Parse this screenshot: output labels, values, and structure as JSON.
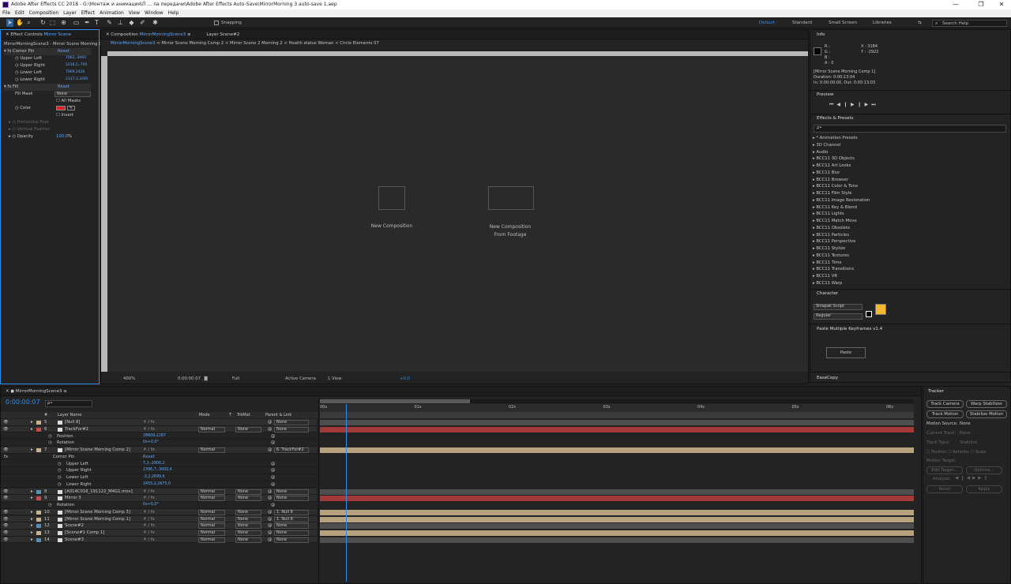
{
  "window": {
    "title": "Adobe After Effects CC 2018 - G:\\Монтаж и анимация\\П ... ла передачи\\Adobe After Effects Auto-Save\\MirrorMorning 3 auto-save 1.aep",
    "minimize": "—",
    "maximize": "❐",
    "close": "✕"
  },
  "menu": [
    "File",
    "Edit",
    "Composition",
    "Layer",
    "Effect",
    "Animation",
    "View",
    "Window",
    "Help"
  ],
  "toolbar": {
    "snapping": "Snapping",
    "workspaces": [
      "Default",
      "Standard",
      "Small Screen",
      "Libraries"
    ],
    "search_placeholder": "Search Help"
  },
  "effect_controls": {
    "tab": "Effect Controls",
    "layer": "Mirror Scene",
    "header": "MirrorMorningScene3 - Mirror Scene Morning Co",
    "corner_pin": "Corner Pin",
    "reset": "Reset",
    "ul": "Upper Left",
    "ul_v": "7062,-3093",
    "ur": "Upper Right",
    "ur_v": "2236,5,-700",
    "ll": "Lower Left",
    "ll_v": "7069,2426",
    "lr": "Lower Right",
    "lr_v": "2137,3,3295",
    "fill": "Fill",
    "fill_reset": "Reset",
    "fill_mask": "Fill Mask",
    "none": "None",
    "all_masks": "All Masks",
    "color": "Color",
    "invert": "Invert",
    "hfeather": "Horizontal Feat",
    "vfeather": "Vertical Feather",
    "opacity": "Opacity",
    "opacity_v": "100,0",
    "pct": "%"
  },
  "composition": {
    "tab": "Composition",
    "comp_name": "MirrorMorningScene3",
    "layer_tab": "Layer Scene#2",
    "breadcrumbs": [
      "MirrorMorningScene3",
      "Mirror Scene Morning Comp 2",
      "Mirror Scene 2 Morning 2",
      "Health status Woman",
      "Circle Elements 07"
    ],
    "new_comp": "New Composition",
    "new_comp_footage_1": "New Composition",
    "new_comp_footage_2": "From Footage",
    "zoom": "400%",
    "timecode": "0:00:00:07",
    "resolution": "Full",
    "camera": "Active Camera",
    "view": "1 View",
    "offset": "+0,0"
  },
  "info": {
    "title": "Info",
    "r": "R :",
    "g": "G :",
    "b": "B :",
    "a": "A : 0",
    "x": "X : 3184",
    "y": "Y : -2922",
    "line1": "[Mirror Scene Morning Comp 1]",
    "line2": "Duration: 0:00:13:04",
    "line3": "In: 0:00:00:00, Out: 0:00:13:03"
  },
  "preview": {
    "title": "Preview"
  },
  "effects": {
    "title": "Effects & Presets",
    "search_placeholder": "ρ•",
    "items": [
      "* Animation Presets",
      "3D Channel",
      "Audio",
      "BCC11 3D Objects",
      "BCC11 Art Looks",
      "BCC11 Blur",
      "BCC11 Browser",
      "BCC11 Color & Tone",
      "BCC11 Film Style",
      "BCC11 Image Restoration",
      "BCC11 Key & Blend",
      "BCC11 Lights",
      "BCC11 Match Move",
      "BCC11 Obsolete",
      "BCC11 Particles",
      "BCC11 Perspective",
      "BCC11 Stylize",
      "BCC11 Textures",
      "BCC11 Time",
      "BCC11 Transitions",
      "BCC11 VR",
      "BCC11 Warp"
    ]
  },
  "character": {
    "title": "Character",
    "font": "Shlapak Script",
    "style": "Regular"
  },
  "paste_kf": {
    "title": "Paste Multiple Keyframes v1.4",
    "button": "Paste"
  },
  "easecopy": {
    "title": "EaseCopy"
  },
  "tracker": {
    "title": "Tracker",
    "track_camera": "Track Camera",
    "warp_stabilizer": "Warp Stabilizer",
    "track_motion": "Track Motion",
    "stabilize_motion": "Stabilize Motion",
    "motion_source": "Motion Source:",
    "motion_source_v": "None",
    "current_track": "Current Track:",
    "current_track_v": "None",
    "track_type": "Track Type:",
    "track_type_v": "Stabilize",
    "position": "Position",
    "rotation": "Rotation",
    "scale": "Scale",
    "motion_target": "Motion Target:",
    "edit_target": "Edit Target...",
    "options": "Options...",
    "analyze": "Analyze:",
    "reset": "Reset",
    "apply": "Apply"
  },
  "timeline": {
    "tab": "MirrorMorningScene3",
    "timecode": "0:00:00:07",
    "search_placeholder": "ρ•",
    "cols": {
      "num": "#",
      "name": "Layer Name",
      "mode": "Mode",
      "t": "T",
      "trkmat": "TrkMat",
      "parent": "Parent & Link"
    },
    "ruler": [
      "00s",
      "01s",
      "02s",
      "03s",
      "04s",
      "05s",
      "06s"
    ],
    "rows": [
      {
        "num": "5",
        "name": "[Null 8]",
        "label": "#c8b48c",
        "mode": "",
        "trk": "",
        "parent": "None",
        "type": "layer"
      },
      {
        "num": "6",
        "name": "TrackFor#2",
        "label": "#c84a4a",
        "mode": "Normal",
        "trk": "None",
        "parent": "None",
        "type": "layer"
      },
      {
        "name": "Position",
        "value": "28609,2287",
        "type": "prop"
      },
      {
        "name": "Rotation",
        "value": "0x+0,0°",
        "type": "prop"
      },
      {
        "num": "7",
        "name": "[Mirror Scene Morning Comp 2]",
        "label": "#c8b48c",
        "mode": "Normal",
        "trk": "",
        "parent": "6. TrackFor#2",
        "type": "layer"
      },
      {
        "name": "Corner Pin",
        "value": "Reset",
        "type": "fx"
      },
      {
        "name": "Upper Left",
        "value": "7,2,-2900,2",
        "type": "prop2"
      },
      {
        "name": "Upper Right",
        "value": "2396,7,-3000,4",
        "type": "prop2"
      },
      {
        "name": "Lower Left",
        "value": "-3,2,2699,6",
        "type": "prop2"
      },
      {
        "name": "Lower Right",
        "value": "2455,2,2675,0",
        "type": "prop2"
      },
      {
        "num": "8",
        "name": "[A014C016_191122_M4G1.mov]",
        "label": "#5a8fb4",
        "mode": "Normal",
        "trk": "None",
        "parent": "None",
        "type": "layer"
      },
      {
        "num": "9",
        "name": "Mirror 3",
        "label": "#c84a4a",
        "mode": "Normal",
        "trk": "None",
        "parent": "None",
        "type": "layer"
      },
      {
        "name": "Rotation",
        "value": "0x+0,0°",
        "type": "prop"
      },
      {
        "num": "10",
        "name": "[Mirror Scene Morning Comp 3]",
        "label": "#c8b48c",
        "mode": "Normal",
        "trk": "None",
        "parent": "1. Null 8",
        "type": "layer"
      },
      {
        "num": "11",
        "name": "[Mirror Scene Morning Comp 1]",
        "label": "#c8b48c",
        "mode": "Normal",
        "trk": "None",
        "parent": "1. Null 8",
        "type": "layer"
      },
      {
        "num": "12",
        "name": "Scene#2",
        "label": "#5a8fb4",
        "mode": "Normal",
        "trk": "None",
        "parent": "None",
        "type": "layer"
      },
      {
        "num": "13",
        "name": "[Scene#1 Comp 1]",
        "label": "#c8b48c",
        "mode": "Normal",
        "trk": "None",
        "parent": "None",
        "type": "layer"
      },
      {
        "num": "14",
        "name": "Scene#3",
        "label": "#5a8fb4",
        "mode": "Normal",
        "trk": "None",
        "parent": "None",
        "type": "layer"
      }
    ]
  },
  "colors": {
    "accent": "#2d8ceb",
    "red_bar": "#a33a3a",
    "tan_bar": "#b8a17e",
    "fill_color": "#e02020",
    "char_fill": "#f5b630"
  }
}
